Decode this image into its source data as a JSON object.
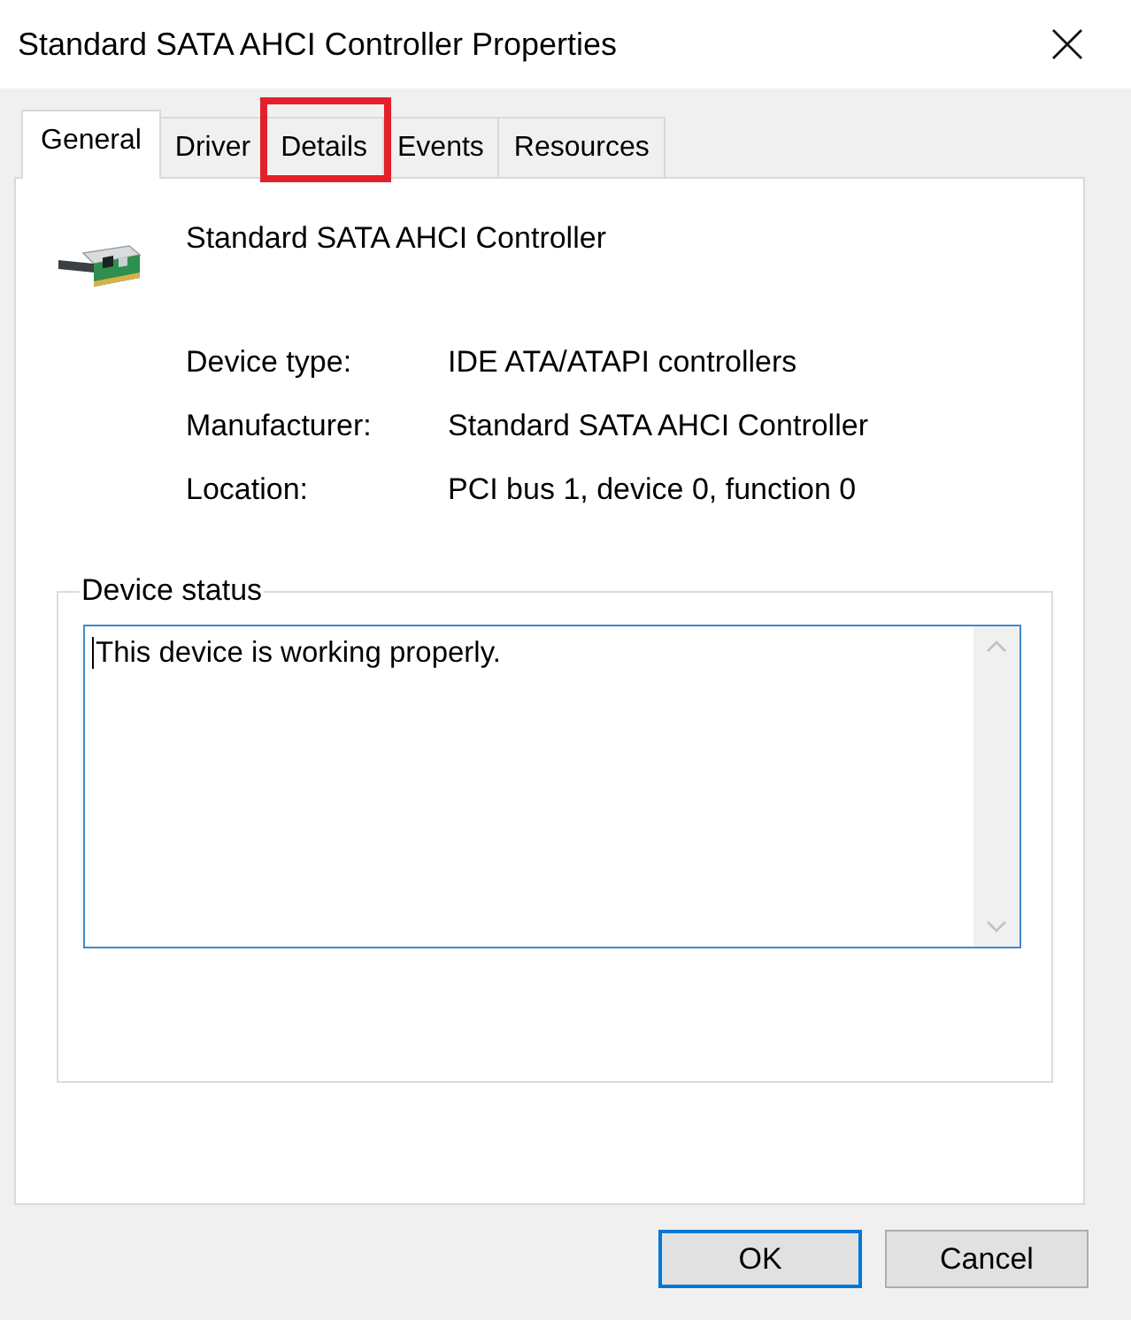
{
  "window": {
    "title": "Standard SATA AHCI Controller Properties"
  },
  "tabs": [
    {
      "label": "General",
      "selected": true,
      "highlighted": false
    },
    {
      "label": "Driver",
      "selected": false,
      "highlighted": false
    },
    {
      "label": "Details",
      "selected": false,
      "highlighted": true
    },
    {
      "label": "Events",
      "selected": false,
      "highlighted": false
    },
    {
      "label": "Resources",
      "selected": false,
      "highlighted": false
    }
  ],
  "device": {
    "name": "Standard SATA AHCI Controller"
  },
  "properties": [
    {
      "label": "Device type:",
      "value": "IDE ATA/ATAPI controllers"
    },
    {
      "label": "Manufacturer:",
      "value": "Standard SATA AHCI Controller"
    },
    {
      "label": "Location:",
      "value": "PCI bus 1, device 0, function 0"
    }
  ],
  "device_status": {
    "title": "Device status",
    "text": "This device is working properly.",
    "focused": true
  },
  "buttons": [
    {
      "label": "OK",
      "default": true
    },
    {
      "label": "Cancel",
      "default": false
    }
  ]
}
